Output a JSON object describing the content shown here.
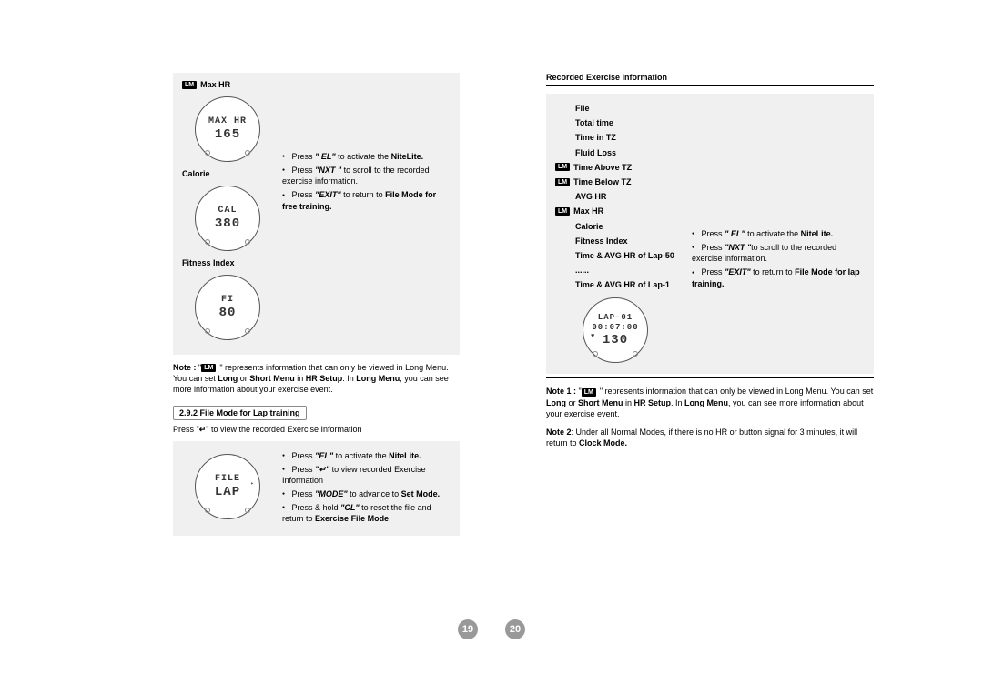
{
  "left": {
    "items": [
      {
        "lm": true,
        "label": "Max HR",
        "face": {
          "l1": "MAX HR",
          "l2": "165"
        }
      },
      {
        "lm": false,
        "label": "Calorie",
        "face": {
          "l1": "CAL",
          "l2": "380"
        }
      },
      {
        "lm": false,
        "label": "Fitness Index",
        "face": {
          "l1": "FI",
          "l2": "80"
        }
      }
    ],
    "instr": {
      "b1_pre": "Press ",
      "b1_q": "\" EL\"",
      "b1_rest": " to activate the ",
      "b1_bold": "NiteLite.",
      "b2_pre": "Press ",
      "b2_q": "\"NXT \"",
      "b2_rest": " to scroll to the recorded exercise information.",
      "b3_pre": "Press ",
      "b3_q": "\"EXIT\"",
      "b3_rest": " to return to ",
      "b3_bold": "File Mode for free training."
    },
    "note": {
      "label": "Note :",
      "pre": " \"",
      "post": "\" represents information that can only be viewed in Long Menu. You can set ",
      "b1": "Long",
      "mid1": " or ",
      "b2": "Short Menu",
      "mid2": " in ",
      "b3": "HR Setup",
      "mid3": ". In ",
      "b4": "Long Menu",
      "tail": ", you can see more information about your exercise event."
    },
    "sectionHead": "2.9.2 File Mode for Lap training",
    "sectionSub_pre": "Press \"",
    "sectionSub_icon": "↵",
    "sectionSub_rest": "\" to view the recorded Exercise Information",
    "lapFace": {
      "l1": "FILE",
      "l2": "LAP"
    },
    "lapInstr": {
      "b1_pre": "Press ",
      "b1_q": "\"EL\"",
      "b1_rest": " to activate the ",
      "b1_bold": "NiteLite.",
      "b2_pre": "Press ",
      "b2_q": "\"↵\"",
      "b2_rest": " to  view recorded Exercise Information",
      "b3_pre": "Press ",
      "b3_q": "\"MODE\"",
      "b3_rest": " to advance to ",
      "b3_bold": "Set Mode.",
      "b4_pre": "Press & hold ",
      "b4_q": "\"CL\"",
      "b4_rest": " to reset the file and return to ",
      "b4_bold": "Exercise File Mode"
    },
    "pageNum": "19"
  },
  "right": {
    "header": "Recorded Exercise Information",
    "list": [
      {
        "lm": false,
        "text": "File"
      },
      {
        "lm": false,
        "text": "Total time"
      },
      {
        "lm": false,
        "text": "Time in TZ"
      },
      {
        "lm": false,
        "text": "Fluid Loss"
      },
      {
        "lm": true,
        "text": "Time Above TZ"
      },
      {
        "lm": true,
        "text": "Time Below TZ"
      },
      {
        "lm": false,
        "text": "AVG HR"
      },
      {
        "lm": true,
        "text": "Max HR"
      },
      {
        "lm": false,
        "text": "Calorie"
      },
      {
        "lm": false,
        "text": "Fitness Index"
      },
      {
        "lm": false,
        "text": "Time & AVG HR of Lap-50"
      },
      {
        "lm": false,
        "text": "......"
      },
      {
        "lm": false,
        "text": "Time & AVG HR of Lap-1"
      }
    ],
    "instr": {
      "b1_pre": "Press ",
      "b1_q": "\" EL\"",
      "b1_rest": " to activate the ",
      "b1_bold": "NiteLite.",
      "b2_pre": "Press ",
      "b2_q": "\"NXT \"",
      "b2_rest": "to scroll to the recorded exercise information.",
      "b3_pre": "Press ",
      "b3_q": "\"EXIT\"",
      "b3_rest": " to return to ",
      "b3_bold": "File Mode for lap training."
    },
    "lapFace": {
      "l1": "LAP-01",
      "l2": "00:07:00",
      "l3": "130"
    },
    "note1": {
      "label": "Note 1 :",
      "pre": " \"",
      "post": "\" represents information that can only be viewed in Long Menu. You can set ",
      "b1": "Long",
      "mid1": " or ",
      "b2": "Short Menu",
      "mid2": " in ",
      "b3": "HR Setup",
      "mid3": ". In ",
      "b4": "Long Menu",
      "tail": ", you can see more information about your exercise event."
    },
    "note2": {
      "label": "Note 2",
      "body": ":  Under all Normal Modes, if there is no HR or button signal for 3 minutes, it will return to ",
      "bold": "Clock Mode."
    },
    "pageNum": "20"
  },
  "lmText": "LM"
}
